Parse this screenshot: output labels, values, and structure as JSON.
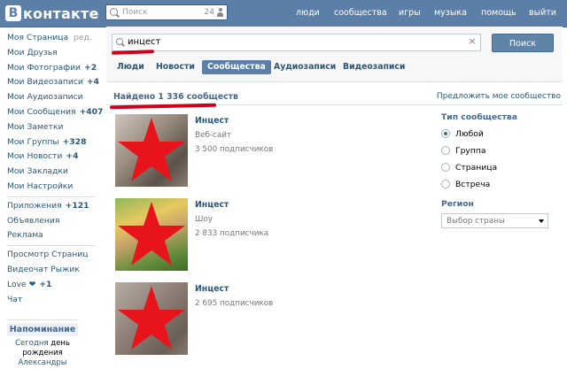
{
  "header": {
    "logo_letter": "В",
    "logo_text": "контакте",
    "search_placeholder": "Поиск",
    "search_count": "24",
    "nav": [
      "люди",
      "сообщества",
      "игры",
      "музыка",
      "помощь",
      "выйти"
    ]
  },
  "sidebar": {
    "items": [
      {
        "label": "Моя Страница",
        "edit": "ред."
      },
      {
        "label": "Мои Друзья"
      },
      {
        "label": "Мои Фотографии",
        "count": "+2"
      },
      {
        "label": "Мои Видеозаписи",
        "count": "+4"
      },
      {
        "label": "Мои Аудиозаписи"
      },
      {
        "label": "Мои Сообщения",
        "count": "+407"
      },
      {
        "label": "Мои Заметки"
      },
      {
        "label": "Мои Группы",
        "count": "+328"
      },
      {
        "label": "Мои Новости",
        "count": "+4"
      },
      {
        "label": "Мои Закладки"
      },
      {
        "label": "Мои Настройки"
      }
    ],
    "apps": [
      {
        "label": "Приложения",
        "count": "+121"
      },
      {
        "label": "Объявления"
      },
      {
        "label": "Реклама"
      }
    ],
    "extra": [
      {
        "label": "Просмотр Страниц"
      },
      {
        "label": "Видеочат Рыжик"
      },
      {
        "label": "Love ❤",
        "count": "+1"
      },
      {
        "label": "Чат"
      }
    ],
    "reminder": {
      "title": "Напоминание",
      "today": "Сегодня",
      "birthday": "день рождения",
      "name": "Александры"
    }
  },
  "search": {
    "query": "инцест",
    "button": "Поиск",
    "tabs": [
      "Люди",
      "Новости",
      "Сообщества",
      "Аудиозаписи",
      "Видеозаписи"
    ],
    "active_tab": "Сообщества"
  },
  "results_header": {
    "found": "Найдено 1 336 сообществ",
    "suggest": "Предложить мое сообщество"
  },
  "results": [
    {
      "name": "Инцест",
      "type": "Веб-сайт",
      "subs": "3 500 подписчиков"
    },
    {
      "name": "Инцест",
      "type": "Шоу",
      "subs": "2 833 подписчика"
    },
    {
      "name": "Инцест",
      "type": "",
      "subs": "2 695 подписчиков"
    }
  ],
  "filters": {
    "type_title": "Тип сообщества",
    "types": [
      "Любой",
      "Группа",
      "Страница",
      "Встреча"
    ],
    "selected_type": "Любой",
    "region_title": "Регион",
    "region_value": "Выбор страны"
  },
  "colors": {
    "header_bg": "#5b7fa6",
    "link": "#2b587a",
    "annotation_red": "#d0021b",
    "star_red": "#e8141c"
  }
}
